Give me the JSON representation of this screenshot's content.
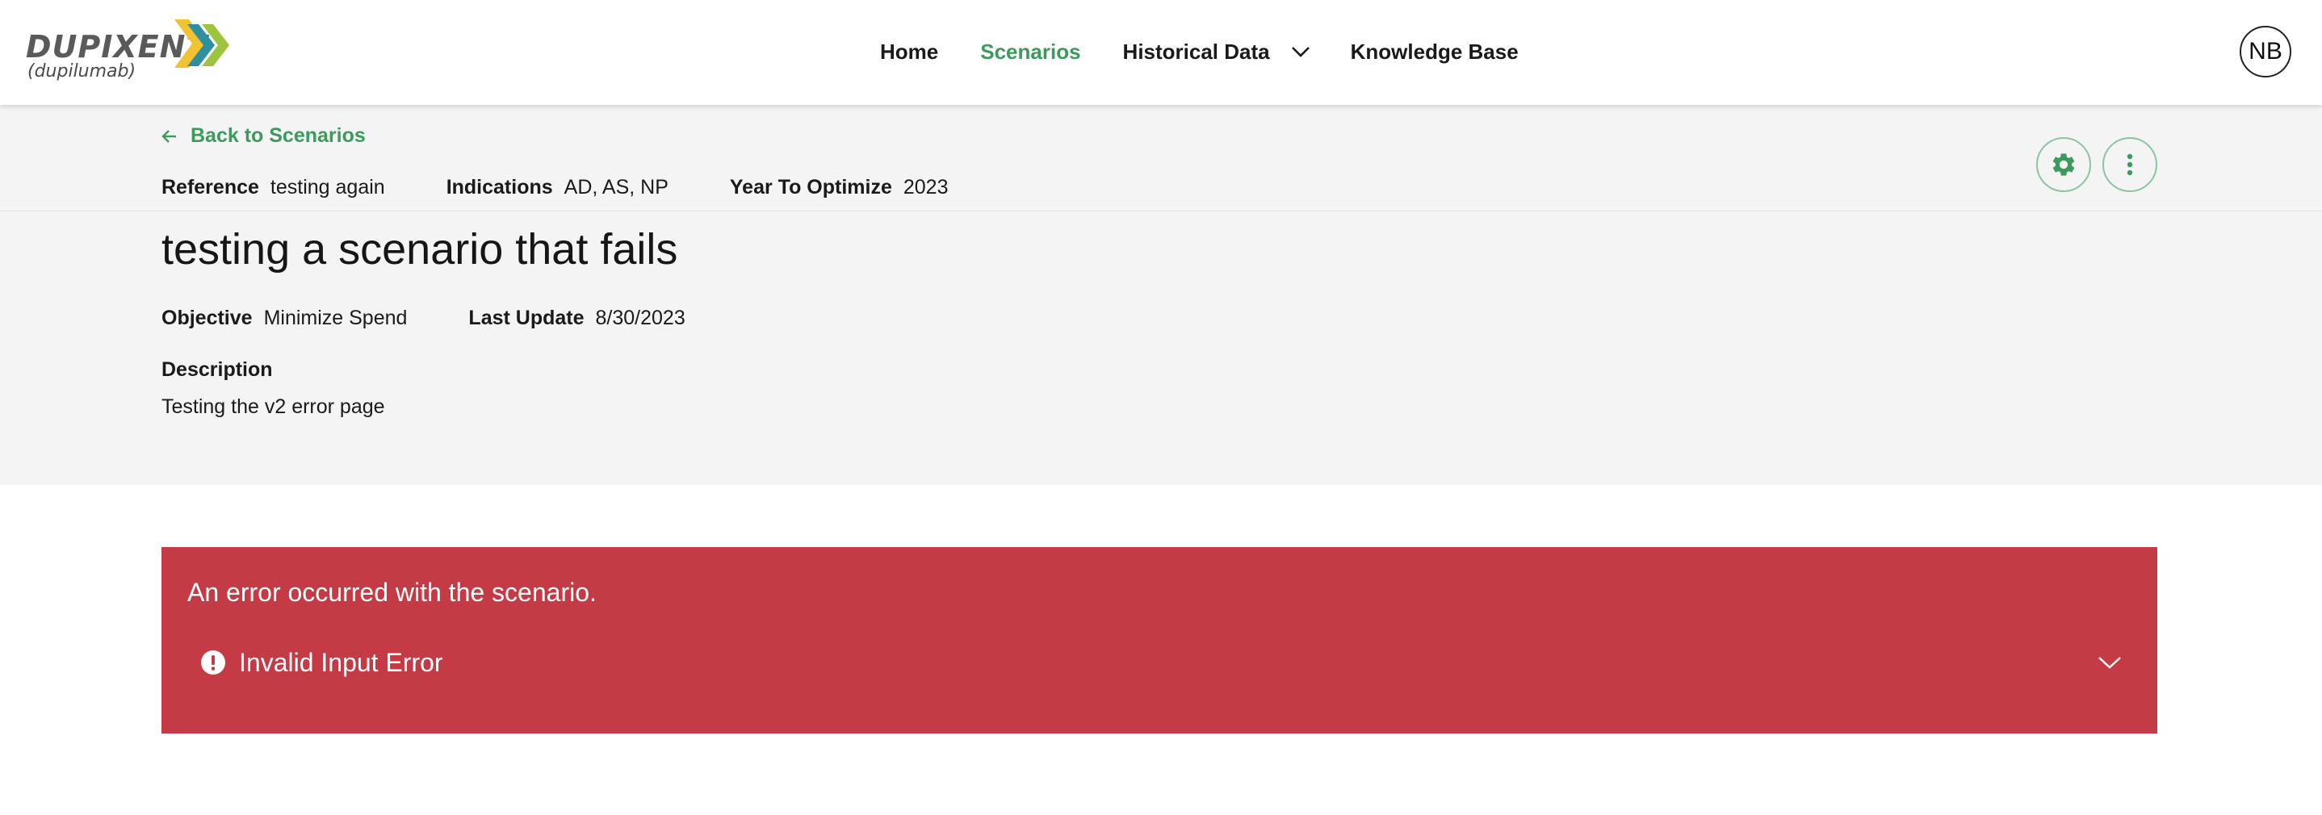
{
  "brand": {
    "name": "DUPIXENT",
    "generic": "(dupilumab)",
    "colors": {
      "yellow": "#f2c232",
      "teal": "#2e8fa0",
      "green": "#9cc43c"
    }
  },
  "nav": {
    "items": [
      {
        "label": "Home",
        "active": false
      },
      {
        "label": "Scenarios",
        "active": true
      },
      {
        "label": "Historical Data",
        "active": false,
        "has_dropdown": true
      },
      {
        "label": "Knowledge Base",
        "active": false
      }
    ],
    "accent_color": "#3d9a5d"
  },
  "user": {
    "initials": "NB"
  },
  "scenario": {
    "back_label": "Back to Scenarios",
    "reference_label": "Reference",
    "reference_value": "testing again",
    "indications_label": "Indications",
    "indications_value": "AD, AS, NP",
    "year_label": "Year To Optimize",
    "year_value": "2023",
    "title": "testing a scenario that fails",
    "objective_label": "Objective",
    "objective_value": "Minimize Spend",
    "last_update_label": "Last Update",
    "last_update_value": "8/30/2023",
    "description_label": "Description",
    "description_value": "Testing the v2 error page",
    "actions": {
      "settings_icon": "gear-icon",
      "more_icon": "more-vertical-icon"
    }
  },
  "error": {
    "message": "An error occurred with the scenario.",
    "item_title": "Invalid Input Error",
    "icon": "alert-circle-icon",
    "color": "#c53b45"
  }
}
